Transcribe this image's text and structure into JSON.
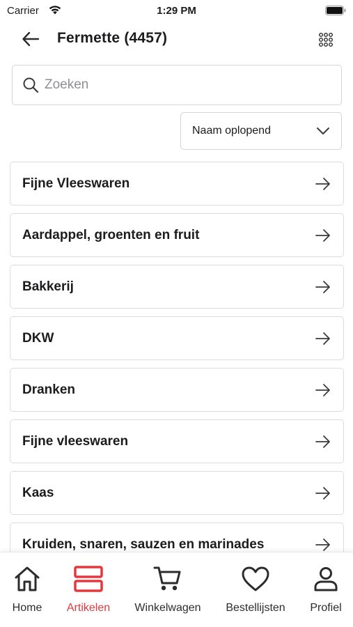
{
  "status_bar": {
    "carrier": "Carrier",
    "time": "1:29 PM"
  },
  "header": {
    "title": "Fermette (4457)",
    "back_icon": "arrow-left-icon",
    "grid_icon": "grid-icon"
  },
  "search": {
    "placeholder": "Zoeken",
    "value": ""
  },
  "sort": {
    "selected": "Naam oplopend"
  },
  "categories": [
    "Fijne Vleeswaren",
    "Aardappel, groenten en fruit",
    "Bakkerij",
    "DKW",
    "Dranken",
    "Fijne vleeswaren",
    "Kaas",
    "Kruiden, snaren, sauzen en marinades"
  ],
  "tabs": [
    {
      "label": "Home",
      "icon": "home-icon",
      "active": false
    },
    {
      "label": "Artikelen",
      "icon": "articles-icon",
      "active": true
    },
    {
      "label": "Winkelwagen",
      "icon": "cart-icon",
      "active": false
    },
    {
      "label": "Bestellijsten",
      "icon": "heart-icon",
      "active": false
    },
    {
      "label": "Profiel",
      "icon": "profile-icon",
      "active": false
    }
  ],
  "colors": {
    "accent": "#e0393e",
    "text": "#1c1c1e",
    "border": "#d4d4d6"
  }
}
